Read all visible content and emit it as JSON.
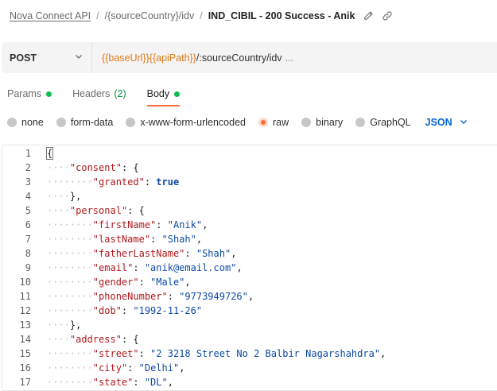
{
  "breadcrumb": {
    "collection": "Nova Connect API",
    "path": "/{sourceCountry}/idv",
    "request": "IND_CIBIL - 200 Success - Anik",
    "separator": "/"
  },
  "request": {
    "method": "POST",
    "url_vars": "{{baseUrl}}{{apiPath}}",
    "url_rest": "/:sourceCountry/idv",
    "url_ellipsis": "...",
    "var_color": "#e07b1a"
  },
  "tabs": [
    {
      "label": "Params",
      "dot": true
    },
    {
      "label": "Headers",
      "count": "(2)"
    },
    {
      "label": "Body",
      "dot": true,
      "active": true
    }
  ],
  "body_types": {
    "options": [
      "none",
      "form-data",
      "x-www-form-urlencoded",
      "raw",
      "binary",
      "GraphQL"
    ],
    "selected": "raw",
    "language": "JSON"
  },
  "editor": {
    "lines": [
      {
        "n": "1",
        "indent": 0,
        "tokens": [
          [
            "p",
            "{"
          ]
        ]
      },
      {
        "n": "2",
        "indent": 1,
        "tokens": [
          [
            "k",
            "\"consent\""
          ],
          [
            "p",
            ":"
          ],
          [
            "p",
            " {"
          ]
        ]
      },
      {
        "n": "3",
        "indent": 2,
        "tokens": [
          [
            "k",
            "\"granted\""
          ],
          [
            "p",
            ":"
          ],
          [
            "b",
            " true"
          ]
        ]
      },
      {
        "n": "4",
        "indent": 1,
        "tokens": [
          [
            "p",
            "},"
          ]
        ]
      },
      {
        "n": "5",
        "indent": 1,
        "tokens": [
          [
            "k",
            "\"personal\""
          ],
          [
            "p",
            ":"
          ],
          [
            "p",
            " {"
          ]
        ]
      },
      {
        "n": "6",
        "indent": 2,
        "tokens": [
          [
            "k",
            "\"firstName\""
          ],
          [
            "p",
            ":"
          ],
          [
            "s",
            " \"Anik\""
          ],
          [
            "p",
            ","
          ]
        ]
      },
      {
        "n": "7",
        "indent": 2,
        "tokens": [
          [
            "k",
            "\"lastName\""
          ],
          [
            "p",
            ":"
          ],
          [
            "s",
            " \"Shah\""
          ],
          [
            "p",
            ","
          ]
        ]
      },
      {
        "n": "8",
        "indent": 2,
        "tokens": [
          [
            "k",
            "\"fatherLastName\""
          ],
          [
            "p",
            ":"
          ],
          [
            "s",
            " \"Shah\""
          ],
          [
            "p",
            ","
          ]
        ]
      },
      {
        "n": "9",
        "indent": 2,
        "tokens": [
          [
            "k",
            "\"email\""
          ],
          [
            "p",
            ":"
          ],
          [
            "s",
            " \"anik@email.com\""
          ],
          [
            "p",
            ","
          ]
        ]
      },
      {
        "n": "10",
        "indent": 2,
        "tokens": [
          [
            "k",
            "\"gender\""
          ],
          [
            "p",
            ":"
          ],
          [
            "s",
            " \"Male\""
          ],
          [
            "p",
            ","
          ]
        ]
      },
      {
        "n": "11",
        "indent": 2,
        "tokens": [
          [
            "k",
            "\"phoneNumber\""
          ],
          [
            "p",
            ":"
          ],
          [
            "s",
            " \"9773949726\""
          ],
          [
            "p",
            ","
          ]
        ]
      },
      {
        "n": "12",
        "indent": 2,
        "tokens": [
          [
            "k",
            "\"dob\""
          ],
          [
            "p",
            ":"
          ],
          [
            "s",
            " \"1992-11-26\""
          ]
        ]
      },
      {
        "n": "13",
        "indent": 1,
        "tokens": [
          [
            "p",
            "},"
          ]
        ]
      },
      {
        "n": "14",
        "indent": 1,
        "tokens": [
          [
            "k",
            "\"address\""
          ],
          [
            "p",
            ":"
          ],
          [
            "p",
            " {"
          ]
        ]
      },
      {
        "n": "15",
        "indent": 2,
        "tokens": [
          [
            "k",
            "\"street\""
          ],
          [
            "p",
            ":"
          ],
          [
            "s",
            " \"2 3218 Street No 2 Balbir Nagarshahdra\""
          ],
          [
            "p",
            ","
          ]
        ]
      },
      {
        "n": "16",
        "indent": 2,
        "tokens": [
          [
            "k",
            "\"city\""
          ],
          [
            "p",
            ":"
          ],
          [
            "s",
            " \"Delhi\""
          ],
          [
            "p",
            ","
          ]
        ]
      },
      {
        "n": "17",
        "indent": 2,
        "tokens": [
          [
            "k",
            "\"state\""
          ],
          [
            "p",
            ":"
          ],
          [
            "s",
            " \"DL\""
          ],
          [
            "p",
            ","
          ]
        ]
      }
    ]
  }
}
